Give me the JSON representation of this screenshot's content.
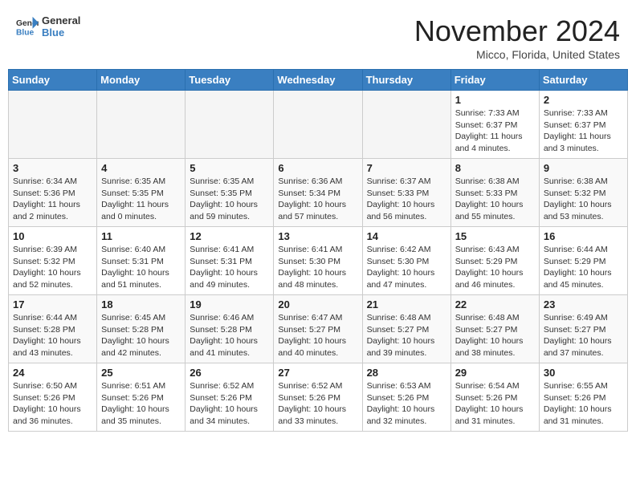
{
  "header": {
    "logo": {
      "line1": "General",
      "line2": "Blue"
    },
    "title": "November 2024",
    "location": "Micco, Florida, United States"
  },
  "weekdays": [
    "Sunday",
    "Monday",
    "Tuesday",
    "Wednesday",
    "Thursday",
    "Friday",
    "Saturday"
  ],
  "weeks": [
    [
      {
        "day": "",
        "empty": true
      },
      {
        "day": "",
        "empty": true
      },
      {
        "day": "",
        "empty": true
      },
      {
        "day": "",
        "empty": true
      },
      {
        "day": "",
        "empty": true
      },
      {
        "day": "1",
        "info": "Sunrise: 7:33 AM\nSunset: 6:37 PM\nDaylight: 11 hours and 4 minutes."
      },
      {
        "day": "2",
        "info": "Sunrise: 7:33 AM\nSunset: 6:37 PM\nDaylight: 11 hours and 3 minutes."
      }
    ],
    [
      {
        "day": "3",
        "info": "Sunrise: 6:34 AM\nSunset: 5:36 PM\nDaylight: 11 hours and 2 minutes."
      },
      {
        "day": "4",
        "info": "Sunrise: 6:35 AM\nSunset: 5:35 PM\nDaylight: 11 hours and 0 minutes."
      },
      {
        "day": "5",
        "info": "Sunrise: 6:35 AM\nSunset: 5:35 PM\nDaylight: 10 hours and 59 minutes."
      },
      {
        "day": "6",
        "info": "Sunrise: 6:36 AM\nSunset: 5:34 PM\nDaylight: 10 hours and 57 minutes."
      },
      {
        "day": "7",
        "info": "Sunrise: 6:37 AM\nSunset: 5:33 PM\nDaylight: 10 hours and 56 minutes."
      },
      {
        "day": "8",
        "info": "Sunrise: 6:38 AM\nSunset: 5:33 PM\nDaylight: 10 hours and 55 minutes."
      },
      {
        "day": "9",
        "info": "Sunrise: 6:38 AM\nSunset: 5:32 PM\nDaylight: 10 hours and 53 minutes."
      }
    ],
    [
      {
        "day": "10",
        "info": "Sunrise: 6:39 AM\nSunset: 5:32 PM\nDaylight: 10 hours and 52 minutes."
      },
      {
        "day": "11",
        "info": "Sunrise: 6:40 AM\nSunset: 5:31 PM\nDaylight: 10 hours and 51 minutes."
      },
      {
        "day": "12",
        "info": "Sunrise: 6:41 AM\nSunset: 5:31 PM\nDaylight: 10 hours and 49 minutes."
      },
      {
        "day": "13",
        "info": "Sunrise: 6:41 AM\nSunset: 5:30 PM\nDaylight: 10 hours and 48 minutes."
      },
      {
        "day": "14",
        "info": "Sunrise: 6:42 AM\nSunset: 5:30 PM\nDaylight: 10 hours and 47 minutes."
      },
      {
        "day": "15",
        "info": "Sunrise: 6:43 AM\nSunset: 5:29 PM\nDaylight: 10 hours and 46 minutes."
      },
      {
        "day": "16",
        "info": "Sunrise: 6:44 AM\nSunset: 5:29 PM\nDaylight: 10 hours and 45 minutes."
      }
    ],
    [
      {
        "day": "17",
        "info": "Sunrise: 6:44 AM\nSunset: 5:28 PM\nDaylight: 10 hours and 43 minutes."
      },
      {
        "day": "18",
        "info": "Sunrise: 6:45 AM\nSunset: 5:28 PM\nDaylight: 10 hours and 42 minutes."
      },
      {
        "day": "19",
        "info": "Sunrise: 6:46 AM\nSunset: 5:28 PM\nDaylight: 10 hours and 41 minutes."
      },
      {
        "day": "20",
        "info": "Sunrise: 6:47 AM\nSunset: 5:27 PM\nDaylight: 10 hours and 40 minutes."
      },
      {
        "day": "21",
        "info": "Sunrise: 6:48 AM\nSunset: 5:27 PM\nDaylight: 10 hours and 39 minutes."
      },
      {
        "day": "22",
        "info": "Sunrise: 6:48 AM\nSunset: 5:27 PM\nDaylight: 10 hours and 38 minutes."
      },
      {
        "day": "23",
        "info": "Sunrise: 6:49 AM\nSunset: 5:27 PM\nDaylight: 10 hours and 37 minutes."
      }
    ],
    [
      {
        "day": "24",
        "info": "Sunrise: 6:50 AM\nSunset: 5:26 PM\nDaylight: 10 hours and 36 minutes."
      },
      {
        "day": "25",
        "info": "Sunrise: 6:51 AM\nSunset: 5:26 PM\nDaylight: 10 hours and 35 minutes."
      },
      {
        "day": "26",
        "info": "Sunrise: 6:52 AM\nSunset: 5:26 PM\nDaylight: 10 hours and 34 minutes."
      },
      {
        "day": "27",
        "info": "Sunrise: 6:52 AM\nSunset: 5:26 PM\nDaylight: 10 hours and 33 minutes."
      },
      {
        "day": "28",
        "info": "Sunrise: 6:53 AM\nSunset: 5:26 PM\nDaylight: 10 hours and 32 minutes."
      },
      {
        "day": "29",
        "info": "Sunrise: 6:54 AM\nSunset: 5:26 PM\nDaylight: 10 hours and 31 minutes."
      },
      {
        "day": "30",
        "info": "Sunrise: 6:55 AM\nSunset: 5:26 PM\nDaylight: 10 hours and 31 minutes."
      }
    ]
  ]
}
